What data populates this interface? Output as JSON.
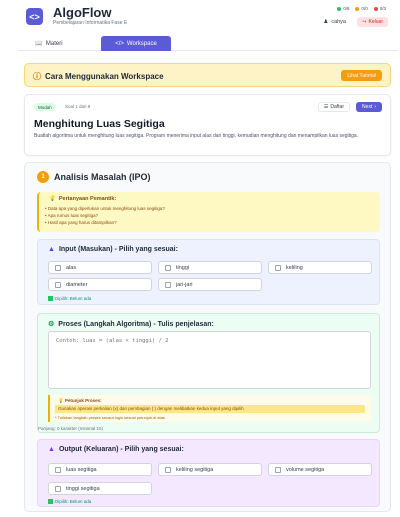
{
  "header": {
    "logo_text": "<>",
    "title": "AlgoFlow",
    "subtitle": "Pembelajaran Informatika Fase E",
    "stats": [
      {
        "label": "0/8",
        "color": "#22c55e"
      },
      {
        "label": "0/0",
        "color": "#f59e0b"
      },
      {
        "label": "0/3",
        "color": "#ef4444"
      }
    ],
    "user_name": "cahya",
    "logout_label": "Keluar"
  },
  "tabs": {
    "materi": "Materi",
    "workspace": "Workspace"
  },
  "howto": {
    "title": "Cara Menggunakan Workspace",
    "button": "Lihat Tutorial"
  },
  "problem": {
    "level": "Mudah",
    "count": "Soal 1 dari 9",
    "list_button": "Daftar",
    "next_button": "Next",
    "title": "Menghitung Luas Segitiga",
    "description": "Buatlah algoritma untuk menghitung luas segitiga. Program menerima input alas dan tinggi, kemudian menghitung dan menampilkan luas segitiga."
  },
  "ipo": {
    "number": "1",
    "title": "Analisis Masalah (IPO)",
    "pertanyaan": {
      "title": "Pertanyaan Pemantik:",
      "items": [
        "Data apa yang diperlukan untuk menghitung luas segitiga?",
        "Apa rumus luas segitiga?",
        "Hasil apa yang harus ditampilkan?"
      ]
    },
    "input": {
      "title": "Input (Masukan) - Pilih yang sesuai:",
      "options": [
        "alas",
        "tinggi",
        "keliling",
        "diameter",
        "jari-jari"
      ],
      "selected_note": "Dipilih: Belum ada"
    },
    "proses": {
      "title": "Proses (Langkah Algoritma) - Tulis penjelasan:",
      "placeholder": "Contoh: luas = (alas × tinggi) / 2",
      "hint_title": "Petunjuk Proses:",
      "hint_text": "Gunakan operasi perkalian (x) dan pembagian (:) dengan melibatkan kedua input yang dipilih",
      "hint_note": "* Tuliskan langkah proses secara logis sesuai petunjuk di atas",
      "char_count": "Panjang: 0 karakter (minimal 15)"
    },
    "output": {
      "title": "Output (Keluaran) - Pilih yang sesuai:",
      "options": [
        "luas segitiga",
        "keliling segitiga",
        "volume segitiga",
        "tinggi segitiga"
      ],
      "selected_note": "Dipilih: Belum ada"
    }
  }
}
